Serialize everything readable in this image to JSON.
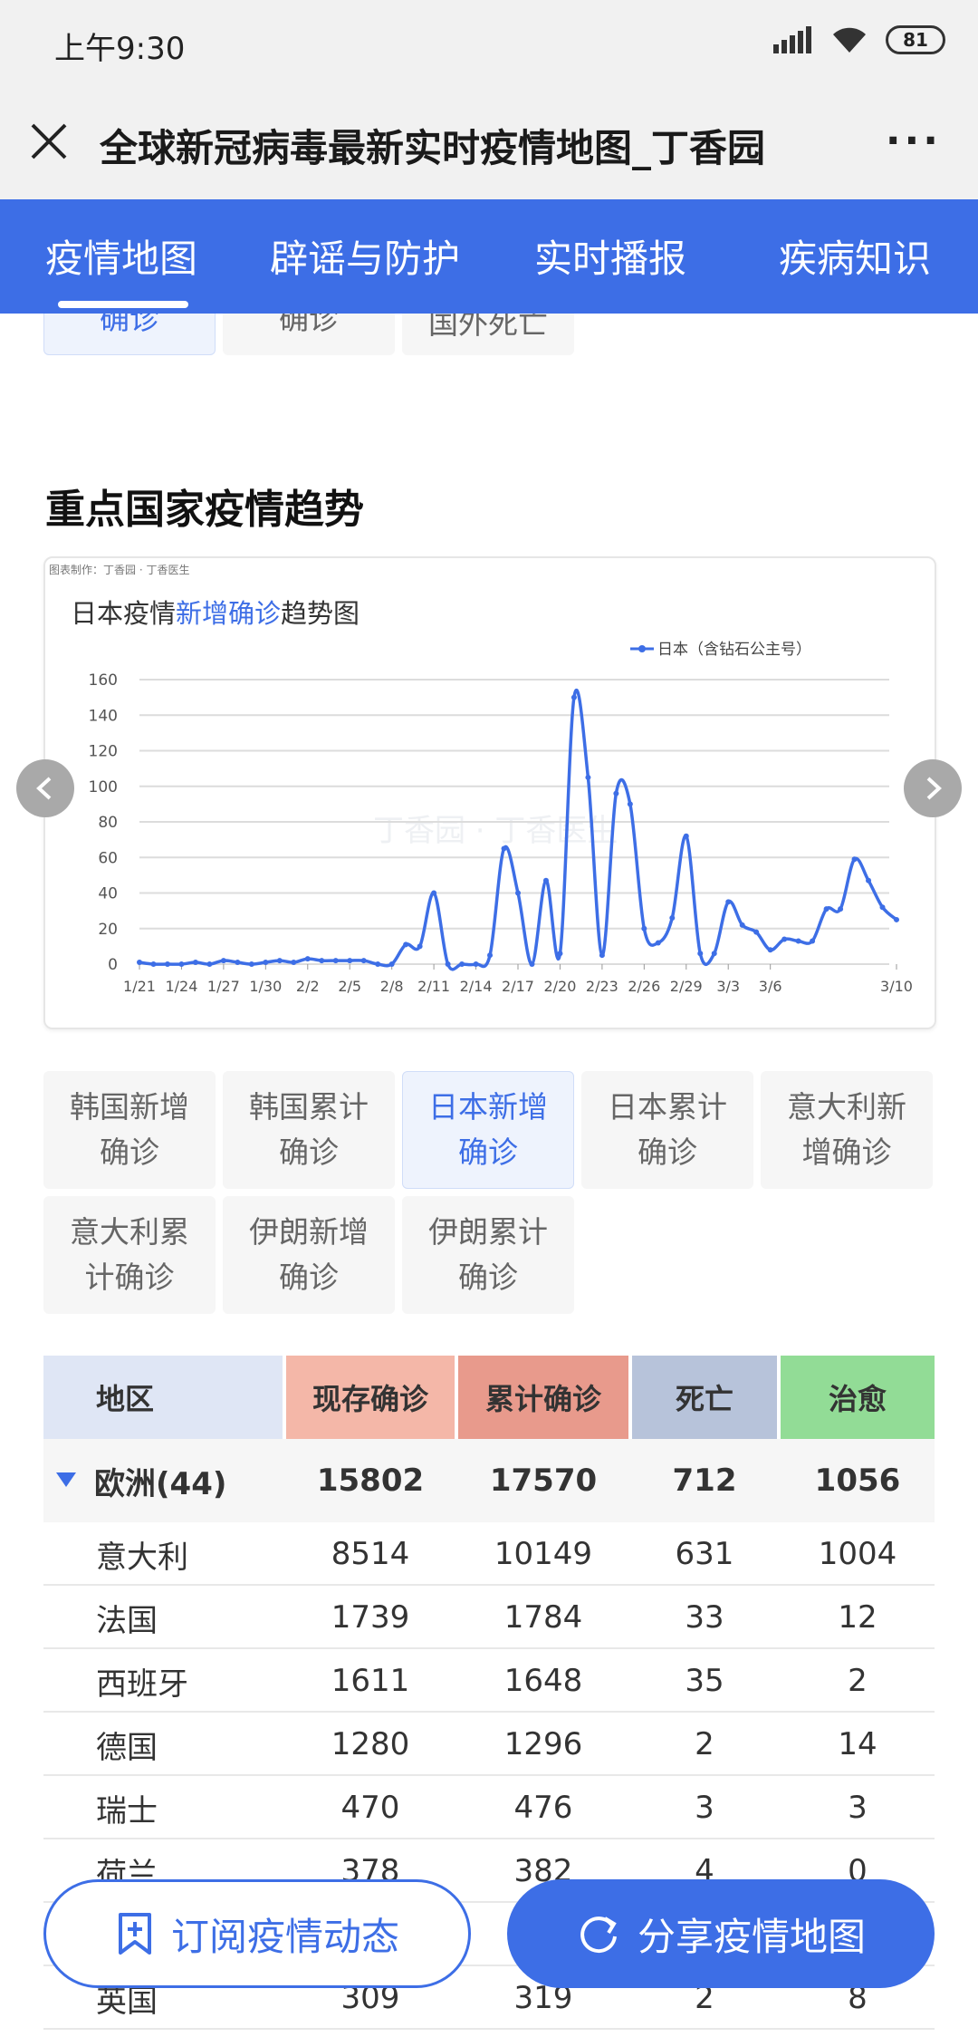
{
  "status": {
    "time": "上午9:30",
    "battery": "81"
  },
  "titlebar": {
    "title": "全球新冠病毒最新实时疫情地图_丁香园"
  },
  "nav": {
    "tabs": [
      "疫情地图",
      "辟谣与防护",
      "实时播报",
      "疾病知识"
    ]
  },
  "top_buttons": [
    "国外新增确诊",
    "国外累计确诊",
    "国外死亡"
  ],
  "section_title": "重点国家疫情趋势",
  "chart_data": {
    "type": "line",
    "credit": "图表制作：丁香园 · 丁香医生",
    "title_parts": [
      "日本疫情",
      "新增确诊",
      "趋势图"
    ],
    "watermark": "丁香园 · 丁香医生",
    "series": [
      {
        "name": "日本（含钻石公主号）",
        "color": "#3d6ee6",
        "values": [
          1,
          0,
          0,
          0,
          1,
          0,
          2,
          1,
          0,
          1,
          2,
          1,
          3,
          2,
          2,
          2,
          2,
          0,
          0,
          11,
          10,
          40,
          0,
          0,
          0,
          5,
          65,
          40,
          0,
          47,
          6,
          150,
          105,
          5,
          96,
          90,
          20,
          12,
          26,
          72,
          6,
          6,
          35,
          22,
          18,
          8,
          14,
          13,
          13,
          31,
          31,
          59,
          47,
          32,
          25
        ]
      }
    ],
    "xticks": [
      "1/21",
      "1/24",
      "1/27",
      "1/30",
      "2/2",
      "2/5",
      "2/8",
      "2/11",
      "2/14",
      "2/17",
      "2/20",
      "2/23",
      "2/26",
      "2/29",
      "3/3",
      "3/6",
      "3/10"
    ],
    "yticks": [
      0,
      20,
      40,
      60,
      80,
      100,
      120,
      140,
      160
    ],
    "ylim": [
      0,
      160
    ],
    "grid": true,
    "legend": "top-right"
  },
  "country_buttons": [
    "韩国新增确诊",
    "韩国累计确诊",
    "日本新增确诊",
    "日本累计确诊",
    "意大利新增确诊",
    "意大利累计确诊",
    "伊朗新增确诊",
    "伊朗累计确诊"
  ],
  "table": {
    "headers": [
      "地区",
      "现存确诊",
      "累计确诊",
      "死亡",
      "治愈"
    ],
    "header_colors": [
      "#dfe6f5",
      "#f4b7a8",
      "#e89a8c",
      "#b7c3da",
      "#92dc96"
    ],
    "group": {
      "name": "欧洲(44)",
      "values": [
        "15802",
        "17570",
        "712",
        "1056"
      ]
    },
    "rows": [
      [
        "意大利",
        "8514",
        "10149",
        "631",
        "1004"
      ],
      [
        "法国",
        "1739",
        "1784",
        "33",
        "12"
      ],
      [
        "西班牙",
        "1611",
        "1648",
        "35",
        "2"
      ],
      [
        "德国",
        "1280",
        "1296",
        "2",
        "14"
      ],
      [
        "瑞士",
        "470",
        "476",
        "3",
        "3"
      ],
      [
        "荷兰",
        "378",
        "382",
        "4",
        "0"
      ],
      [
        "",
        "",
        "",
        "",
        ""
      ],
      [
        "英国",
        "309",
        "319",
        "2",
        "8"
      ]
    ]
  },
  "float_buttons": {
    "subscribe": "订阅疫情动态",
    "share": "分享疫情地图"
  }
}
